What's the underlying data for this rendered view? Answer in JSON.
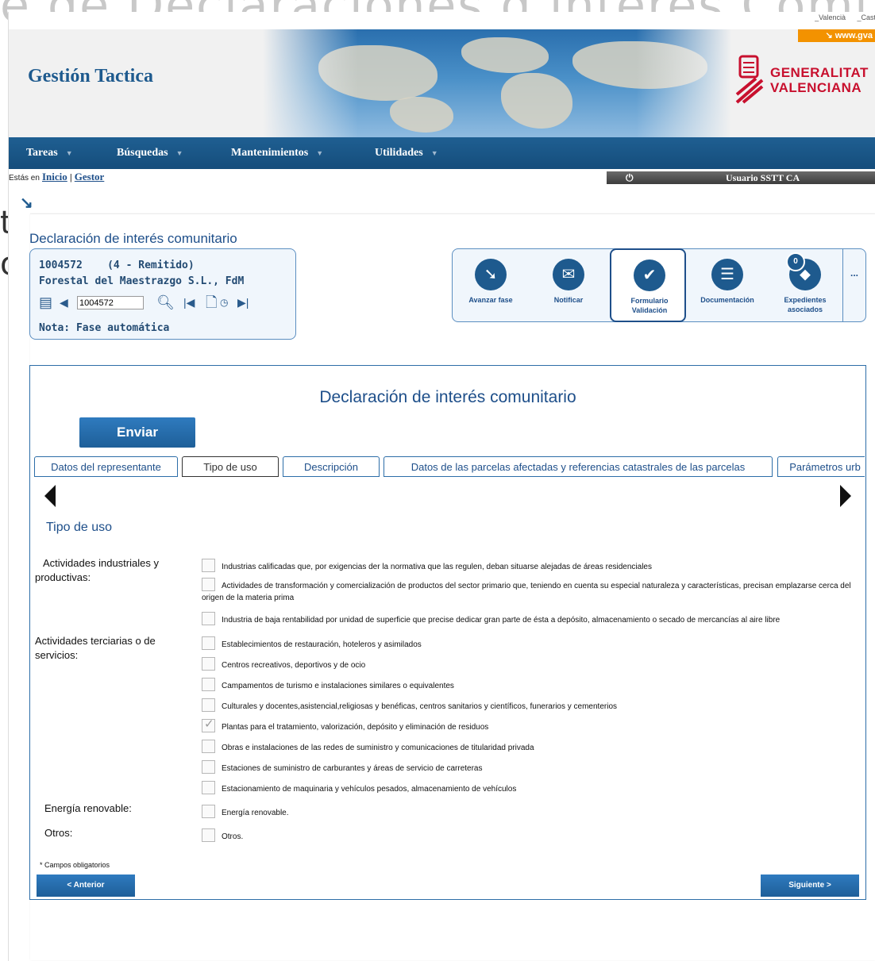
{
  "background_title": "e de Declaraciones d interés Comu",
  "side_chars": [
    "t",
    "o"
  ],
  "languages": [
    "_Valencià",
    "_Cast"
  ],
  "header": {
    "app_title": "Gestión Tactica",
    "web_link": "www.gva",
    "brand_line1": "GENERALITAT",
    "brand_line2": "VALENCIANA",
    "brand_color": "#c8102e",
    "accent_color": "#1e5a8e"
  },
  "menu": [
    {
      "label": "Tareas"
    },
    {
      "label": "Búsquedas"
    },
    {
      "label": "Mantenimientos"
    },
    {
      "label": "Utilidades"
    }
  ],
  "breadcrumb": {
    "prefix": "Estás en",
    "items": [
      "Inicio",
      "Gestor"
    ],
    "separator": "|"
  },
  "user": {
    "power_icon": "⏻",
    "name": "Usuario SSTT CA"
  },
  "expediente": {
    "section_title": "Declaración de interés comunitario",
    "number": "1004572",
    "state": "(4 - Remitido)",
    "company": "Forestal del Maestrazgo S.L., FdM",
    "search_value": "1004572",
    "note": "Nota: Fase automática"
  },
  "toolbar": {
    "items": [
      {
        "label": "Avanzar fase",
        "icon": "advance-icon"
      },
      {
        "label": "Notificar",
        "icon": "envelope-icon"
      },
      {
        "label": "Formulario Validación",
        "icon": "form-check-icon"
      },
      {
        "label": "Documentación",
        "icon": "document-icon"
      },
      {
        "label": "Expedientes asociados",
        "icon": "link-icon",
        "badge": "0"
      }
    ],
    "more": "..."
  },
  "form": {
    "title": "Declaración de interés comunitario",
    "send_label": "Enviar",
    "tabs": [
      "Datos del representante",
      "Tipo de uso",
      "Descripción",
      "Datos de las parcelas afectadas y referencias catastrales de las parcelas",
      "Parámetros urb"
    ],
    "section": "Tipo de uso",
    "groups": [
      {
        "label": "Actividades industriales y productivas:"
      },
      {
        "label": "Actividades terciarias o de servicios:"
      },
      {
        "label": "Energía renovable:"
      },
      {
        "label": "Otros:"
      }
    ],
    "options": [
      {
        "text": "Industrias calificadas que, por exigencias der la normativa que las regulen, deban situarse alejadas de áreas residenciales",
        "checked": false
      },
      {
        "text": "Actividades de transformación y comercialización de productos del sector primario que, teniendo en cuenta su especial naturaleza y características, precisan emplazarse cerca del origen de la materia prima",
        "checked": false
      },
      {
        "text": "Industria de baja rentabilidad por unidad de superficie que precise dedicar gran parte de ésta a depósito, almacenamiento o secado de mercancías al aire libre",
        "checked": false
      },
      {
        "text": "Establecimientos de restauración, hoteleros y asimilados",
        "checked": false
      },
      {
        "text": "Centros recreativos, deportivos y de ocio",
        "checked": false
      },
      {
        "text": "Campamentos de turismo e instalaciones similares o equivalentes",
        "checked": false
      },
      {
        "text": "Culturales y docentes,asistencial,religiosas y benéficas, centros sanitarios y científicos, funerarios y cementerios",
        "checked": false
      },
      {
        "text": "Plantas para el tratamiento, valorización, depósito y eliminación de residuos",
        "checked": true
      },
      {
        "text": "Obras e instalaciones de las redes de suministro y comunicaciones de titularidad privada",
        "checked": false
      },
      {
        "text": "Estaciones de suministro de carburantes y áreas de servicio de carreteras",
        "checked": false
      },
      {
        "text": "Estacionamiento de maquinaria y vehículos pesados, almacenamiento de vehículos",
        "checked": false
      },
      {
        "text": "Energía renovable.",
        "checked": false
      },
      {
        "text": "Otros.",
        "checked": false
      }
    ],
    "required_note": "* Campos obligatorios",
    "prev_label": "< Anterior",
    "next_label": "Siguiente >"
  }
}
